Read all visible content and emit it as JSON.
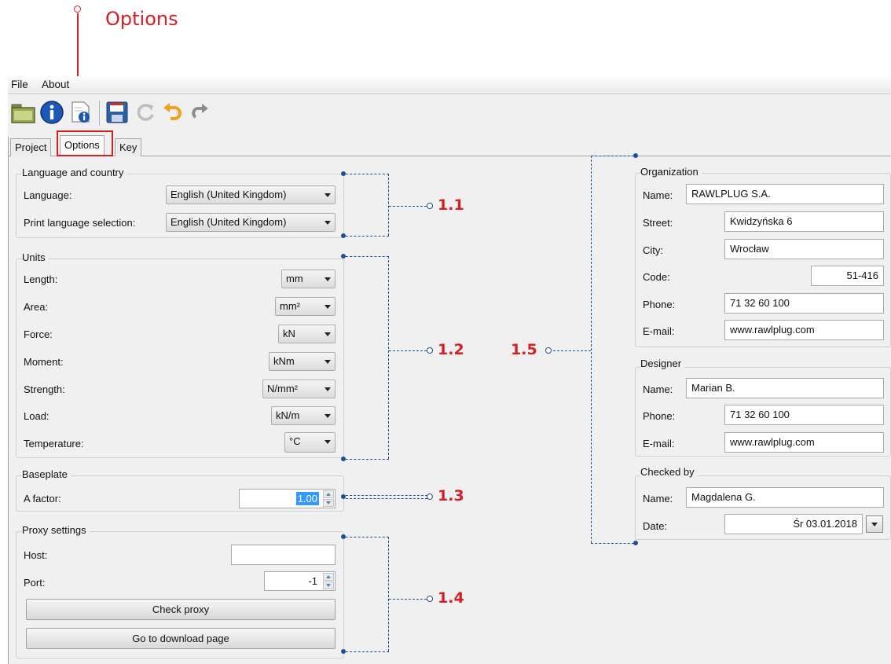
{
  "annotation": {
    "title": "Options"
  },
  "menu": {
    "file": "File",
    "about": "About"
  },
  "toolbar": {
    "icons": [
      "open-folder-icon",
      "info-icon",
      "document-info-icon",
      "save-icon",
      "refresh-icon",
      "undo-icon",
      "redo-icon"
    ]
  },
  "tabs": {
    "project": "Project",
    "options": "Options",
    "key": "Key"
  },
  "language": {
    "title": "Language and country",
    "language_label": "Language:",
    "language_value": "English (United Kingdom)",
    "print_label": "Print language selection:",
    "print_value": "English (United Kingdom)"
  },
  "units": {
    "title": "Units",
    "length_label": "Length:",
    "length_value": "mm",
    "area_label": "Area:",
    "area_value": "mm²",
    "force_label": "Force:",
    "force_value": "kN",
    "moment_label": "Moment:",
    "moment_value": "kNm",
    "strength_label": "Strength:",
    "strength_value": "N/mm²",
    "load_label": "Load:",
    "load_value": "kN/m",
    "temperature_label": "Temperature:",
    "temperature_value": "°C"
  },
  "baseplate": {
    "title": "Baseplate",
    "factor_label": "A factor:",
    "factor_value": "1.00"
  },
  "proxy": {
    "title": "Proxy settings",
    "host_label": "Host:",
    "host_value": "",
    "port_label": "Port:",
    "port_value": "-1",
    "check_button": "Check proxy",
    "download_button": "Go to download page"
  },
  "organization": {
    "title": "Organization",
    "name_label": "Name:",
    "name_value": "RAWLPLUG S.A.",
    "street_label": "Street:",
    "street_value": "Kwidzyńska 6",
    "city_label": "City:",
    "city_value": "Wrocław",
    "code_label": "Code:",
    "code_value": "51-416",
    "phone_label": "Phone:",
    "phone_value": "71 32 60 100",
    "email_label": "E-mail:",
    "email_value": "www.rawlplug.com"
  },
  "designer": {
    "title": "Designer",
    "name_label": "Name:",
    "name_value": "Marian B.",
    "phone_label": "Phone:",
    "phone_value": "71 32 60 100",
    "email_label": "E-mail:",
    "email_value": "www.rawlplug.com"
  },
  "checked": {
    "title": "Checked by",
    "name_label": "Name:",
    "name_value": "Magdalena G.",
    "date_label": "Date:",
    "date_value": "Śr 03.01.2018"
  },
  "markers": {
    "m11": "1.1",
    "m12": "1.2",
    "m13": "1.3",
    "m14": "1.4",
    "m15": "1.5"
  },
  "colors": {
    "accent_red": "#d31f26",
    "callout_blue": "#1f4f8e",
    "selection_blue": "#3399ff"
  }
}
